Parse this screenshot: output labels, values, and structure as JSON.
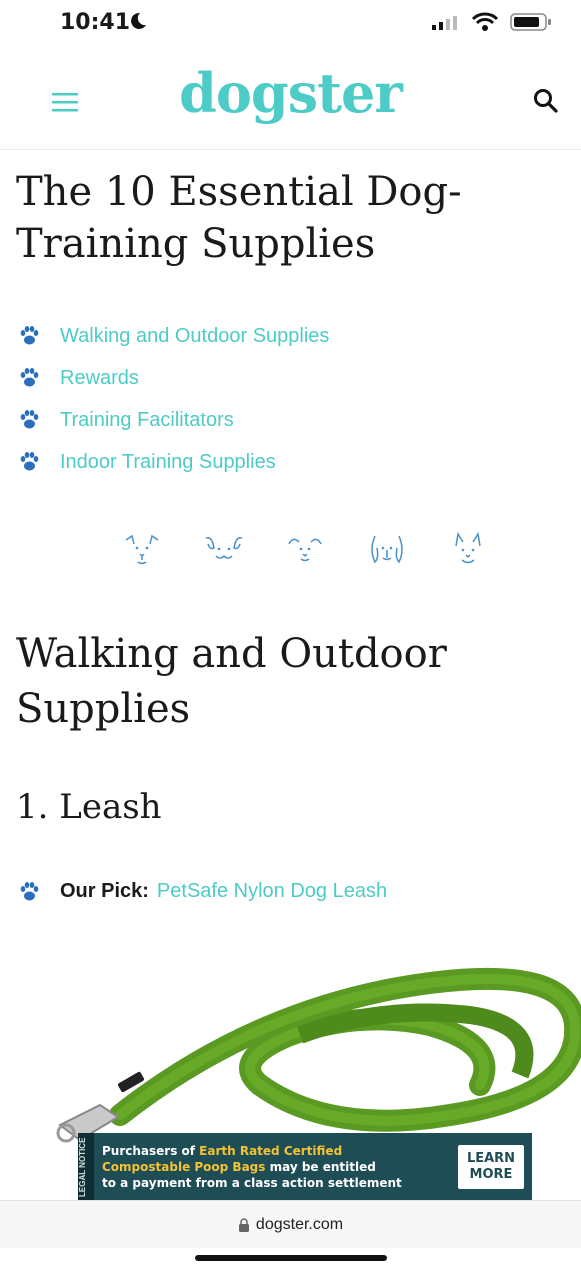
{
  "status_bar": {
    "time": "10:41"
  },
  "header": {
    "logo": "dogster"
  },
  "article": {
    "title": "The 10 Essential Dog-Training Supplies",
    "toc": [
      {
        "label": "Walking and Outdoor Supplies"
      },
      {
        "label": "Rewards"
      },
      {
        "label": "Training Facilitators"
      },
      {
        "label": "Indoor Training Supplies"
      }
    ],
    "section_title": "Walking and Outdoor Supplies",
    "item_title": "1. Leash",
    "our_pick_label": "Our Pick:",
    "our_pick_link": "PetSafe Nylon Dog Leash"
  },
  "ad": {
    "tag": "LEGAL NOTICE",
    "line1_prefix": "Purchasers of ",
    "line1_highlight": "Earth Rated Certified",
    "line2_highlight": "Compostable Poop Bags",
    "line2_suffix": " may be entitled",
    "line3": "to a payment from a class action settlement",
    "cta": "LEARN MORE"
  },
  "browser": {
    "url": "dogster.com"
  },
  "colors": {
    "accent": "#4dcbc6",
    "paw": "#2a6fbe",
    "leash": "#5a9a22"
  }
}
